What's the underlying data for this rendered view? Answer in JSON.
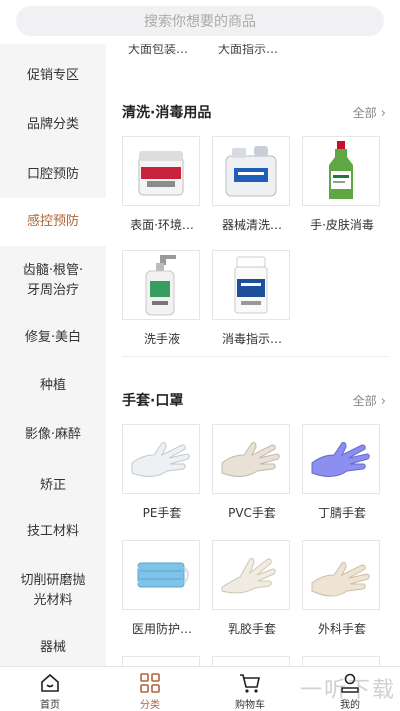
{
  "search": {
    "placeholder": "搜索你想要的商品"
  },
  "sidebar": {
    "items": [
      {
        "label": "促销专区"
      },
      {
        "label": "品牌分类"
      },
      {
        "label": "口腔预防"
      },
      {
        "label": "感控预防",
        "active": true
      },
      {
        "label": "齿髓·根管·\n牙周治疗"
      },
      {
        "label": "修复·美白"
      },
      {
        "label": "种植"
      },
      {
        "label": "影像·麻醉"
      },
      {
        "label": "矫正"
      },
      {
        "label": "技工材料"
      },
      {
        "label": "切削研磨抛\n光材料"
      },
      {
        "label": "器械"
      }
    ]
  },
  "main": {
    "cut_names": [
      "大面包装…",
      "大面指示…"
    ],
    "sections": [
      {
        "title": "清洗·消毒用品",
        "more": "全部",
        "products": [
          {
            "name": "表面·环境…",
            "icon": "wipes-tub"
          },
          {
            "name": "器械清洗…",
            "icon": "cleaner-jug"
          },
          {
            "name": "手·皮肤消毒",
            "icon": "green-bottle"
          },
          {
            "name": "洗手液",
            "icon": "pump-bottle"
          },
          {
            "name": "消毒指示…",
            "icon": "indicator-jar"
          }
        ]
      },
      {
        "title": "手套·口罩",
        "more": "全部",
        "products": [
          {
            "name": "PE手套",
            "icon": "clear-glove"
          },
          {
            "name": "PVC手套",
            "icon": "pvc-glove"
          },
          {
            "name": "丁腈手套",
            "icon": "blue-glove"
          },
          {
            "name": "医用防护…",
            "icon": "mask"
          },
          {
            "name": "乳胶手套",
            "icon": "latex-glove"
          },
          {
            "name": "外科手套",
            "icon": "surgical-glove"
          }
        ]
      }
    ]
  },
  "tabbar": {
    "tabs": [
      {
        "label": "首页",
        "icon": "home-icon"
      },
      {
        "label": "分类",
        "icon": "category-icon",
        "active": true
      },
      {
        "label": "购物车",
        "icon": "cart-icon"
      },
      {
        "label": "我的",
        "icon": "user-icon"
      }
    ]
  },
  "watermark": "一听下载",
  "colors": {
    "accent": "#b0643a",
    "sidebar_bg": "#f5f5f5"
  }
}
